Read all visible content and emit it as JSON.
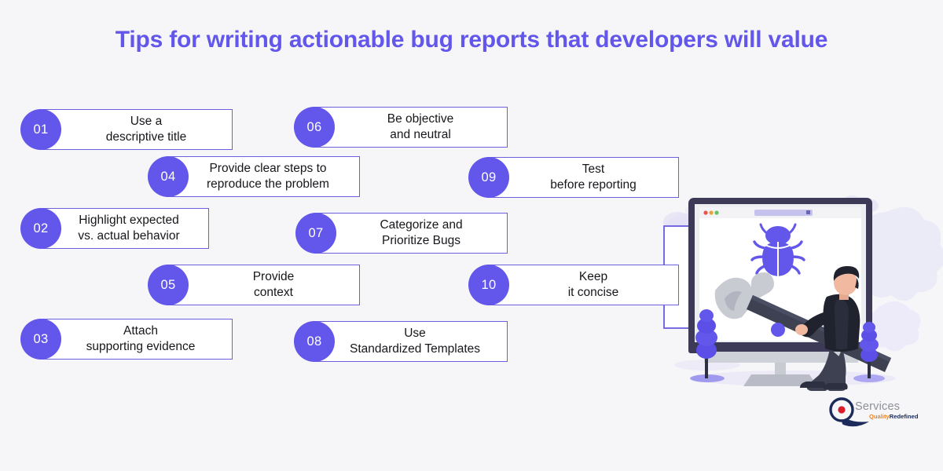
{
  "page": {
    "title": "Tips for writing actionable bug reports that developers will value",
    "background_color": "#f6f6f8",
    "accent_color": "#6257ea",
    "box_border_color": "#6b5fe0",
    "box_fill_color": "#ffffff",
    "text_color": "#17171b"
  },
  "tips": [
    {
      "number": "01",
      "line1": "Use a",
      "line2": "descriptive title"
    },
    {
      "number": "04",
      "line1": "Provide clear steps to",
      "line2": "reproduce the problem"
    },
    {
      "number": "02",
      "line1": "Highlight expected",
      "line2": "vs. actual behavior"
    },
    {
      "number": "05",
      "line1": "Provide",
      "line2": "context"
    },
    {
      "number": "03",
      "line1": "Attach",
      "line2": "supporting evidence"
    },
    {
      "number": "06",
      "line1": "Be objective",
      "line2": "and neutral"
    },
    {
      "number": "09",
      "line1": "Test",
      "line2": "before reporting"
    },
    {
      "number": "07",
      "line1": "Categorize and",
      "line2": "Prioritize Bugs"
    },
    {
      "number": "10",
      "line1": "Keep",
      "line2": "it concise"
    },
    {
      "number": "08",
      "line1": "Use",
      "line2": "Standardized Templates"
    }
  ],
  "illustration": {
    "bug_icon": "bug-icon",
    "monitor_icon": "monitor-icon",
    "hammer_icon": "hammer-icon",
    "person_icon": "person-icon",
    "browser_dots": [
      "red",
      "orange",
      "green"
    ],
    "bug_color": "#6257ea",
    "monitor_frame_color": "#3c3a56",
    "hammer_head_color": "#c9cbd3",
    "hammer_handle_color": "#3d4152"
  },
  "logo": {
    "mark": "q-ring-icon",
    "name": "Services",
    "tagline_part1": "Quality",
    "tagline_part2": "Redefined",
    "ring_color": "#1b2a5a",
    "dot_color": "#d81c2a",
    "name_color": "#8d9098",
    "tagline1_color": "#f0821e",
    "tagline2_color": "#1b2a5a"
  }
}
